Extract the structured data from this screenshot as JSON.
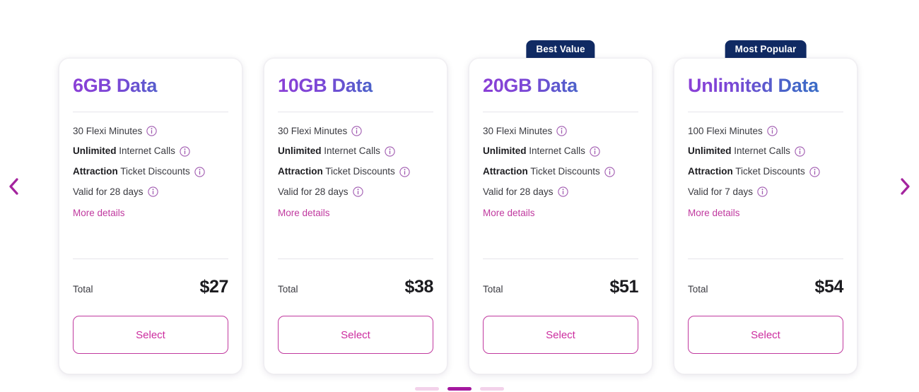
{
  "carousel": {
    "prev_label": "Previous plans",
    "next_label": "Next plans",
    "prev_icon": "chevron-left-icon",
    "next_icon": "chevron-right-icon"
  },
  "colors": {
    "badge_bg": "#102a63",
    "badge_text": "#ffffff",
    "title_gradient_start": "#8b3fd6",
    "title_gradient_end": "#2d72c4",
    "accent_magenta": "#c0399f",
    "link_magenta": "#c0399f",
    "info_icon": "#a05ab0",
    "page_active": "#a4189f",
    "page_inactive": "#f3d2ea",
    "card_bg": "#ffffff",
    "divider": "#e6e4ea",
    "price_text": "#1b1b1f"
  },
  "labels": {
    "total": "Total",
    "more_details": "More details",
    "select": "Select",
    "info_icon_name": "info-icon"
  },
  "plans": [
    {
      "badge": "",
      "title": "6GB Data",
      "features": [
        {
          "strong": "",
          "plain": "30 Flexi Minutes"
        },
        {
          "strong": "Unlimited",
          "plain": "Internet Calls"
        },
        {
          "strong": "Attraction",
          "plain": "Ticket Discounts"
        },
        {
          "strong": "",
          "plain": "Valid for 28 days"
        }
      ],
      "more_details": "More details",
      "total_label": "Total",
      "price": "$27",
      "select_label": "Select"
    },
    {
      "badge": "",
      "title": "10GB Data",
      "features": [
        {
          "strong": "",
          "plain": "30 Flexi Minutes"
        },
        {
          "strong": "Unlimited",
          "plain": "Internet Calls"
        },
        {
          "strong": "Attraction",
          "plain": "Ticket Discounts"
        },
        {
          "strong": "",
          "plain": "Valid for 28 days"
        }
      ],
      "more_details": "More details",
      "total_label": "Total",
      "price": "$38",
      "select_label": "Select"
    },
    {
      "badge": "Best Value",
      "title": "20GB Data",
      "features": [
        {
          "strong": "",
          "plain": "30 Flexi Minutes"
        },
        {
          "strong": "Unlimited",
          "plain": "Internet Calls"
        },
        {
          "strong": "Attraction",
          "plain": "Ticket Discounts"
        },
        {
          "strong": "",
          "plain": "Valid for 28 days"
        }
      ],
      "more_details": "More details",
      "total_label": "Total",
      "price": "$51",
      "select_label": "Select"
    },
    {
      "badge": "Most Popular",
      "title": "Unlimited Data",
      "features": [
        {
          "strong": "",
          "plain": "100 Flexi Minutes"
        },
        {
          "strong": "Unlimited",
          "plain": "Internet Calls"
        },
        {
          "strong": "Attraction",
          "plain": "Ticket Discounts"
        },
        {
          "strong": "",
          "plain": "Valid for 7 days"
        }
      ],
      "more_details": "More details",
      "total_label": "Total",
      "price": "$54",
      "select_label": "Select"
    }
  ],
  "pagination": {
    "count": 3,
    "active_index": 1
  }
}
